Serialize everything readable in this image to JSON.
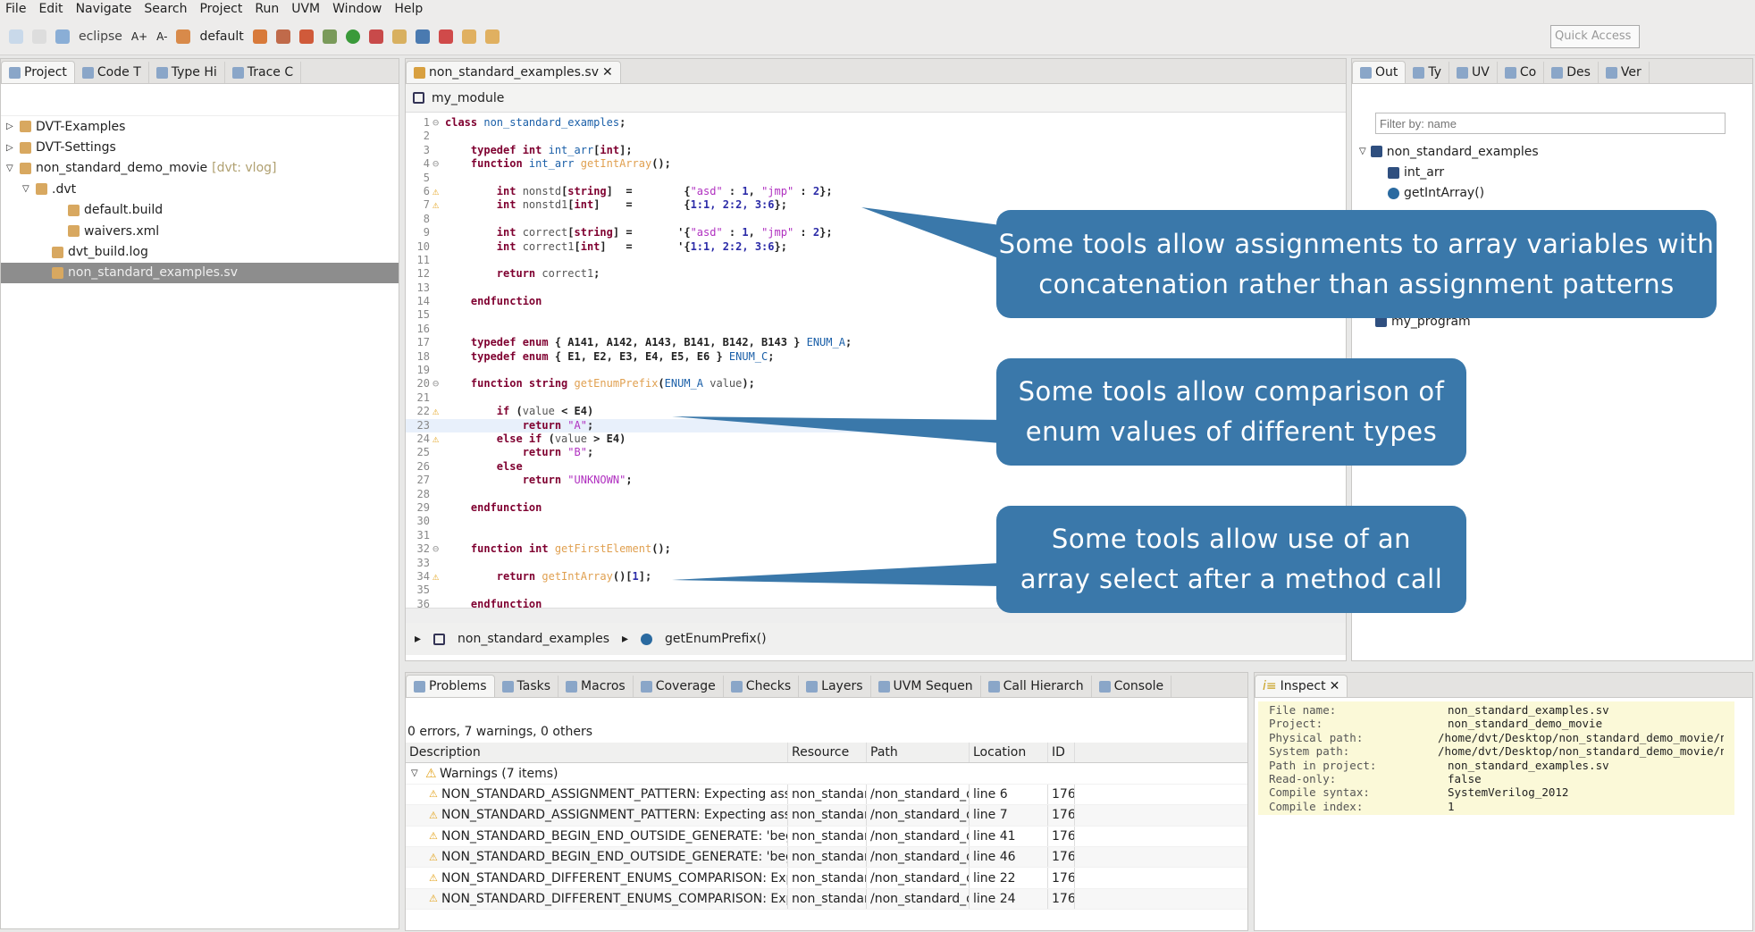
{
  "menu": [
    "File",
    "Edit",
    "Navigate",
    "Search",
    "Project",
    "Run",
    "UVM",
    "Window",
    "Help"
  ],
  "toolbar": {
    "perspective1": "eclipse",
    "font_up": "A+",
    "font_down": "A-",
    "config": "default",
    "quick_access": "Quick Access"
  },
  "project_panel": {
    "tabs": [
      "Project",
      "Code T",
      "Type Hi",
      "Trace C"
    ],
    "tree": [
      {
        "label": "DVT-Examples",
        "level": 0,
        "arrow": "▷"
      },
      {
        "label": "DVT-Settings",
        "level": 0,
        "arrow": "▷"
      },
      {
        "label": "non_standard_demo_movie",
        "suffix": "[dvt: vlog]",
        "level": 0,
        "arrow": "▽"
      },
      {
        "label": ".dvt",
        "level": 1,
        "arrow": "▽"
      },
      {
        "label": "default.build",
        "level": 3,
        "arrow": ""
      },
      {
        "label": "waivers.xml",
        "level": 3,
        "arrow": ""
      },
      {
        "label": "dvt_build.log",
        "level": 2,
        "arrow": ""
      },
      {
        "label": "non_standard_examples.sv",
        "level": 2,
        "arrow": "",
        "selected": true
      }
    ]
  },
  "editor": {
    "tab": "non_standard_examples.sv",
    "module": "my_module",
    "breadcrumb": [
      "non_standard_examples",
      "getEnumPrefix()"
    ],
    "lines": [
      {
        "n": "1",
        "f": "⊖",
        "s": [
          [
            "class ",
            "kw"
          ],
          [
            "non_standard_examples",
            "ty"
          ],
          [
            ";",
            "pl"
          ]
        ]
      },
      {
        "n": "2",
        "s": []
      },
      {
        "n": "3",
        "s": [
          [
            "    typedef int ",
            "kw"
          ],
          [
            "int_arr",
            "ty"
          ],
          [
            "[",
            "pl"
          ],
          [
            "int",
            "kw"
          ],
          [
            "];",
            "pl"
          ]
        ]
      },
      {
        "n": "4",
        "f": "⊖",
        "s": [
          [
            "    function ",
            "kw"
          ],
          [
            "int_arr ",
            "ty"
          ],
          [
            "getIntArray",
            "fn"
          ],
          [
            "();",
            "pl"
          ]
        ]
      },
      {
        "n": "5",
        "s": []
      },
      {
        "n": "6",
        "w": true,
        "s": [
          [
            "        int ",
            "kw"
          ],
          [
            "nonstd",
            "id"
          ],
          [
            "[",
            "pl"
          ],
          [
            "string",
            "kw"
          ],
          [
            "]  =        {",
            "pl"
          ],
          [
            "\"asd\"",
            "str"
          ],
          [
            " : ",
            "pl"
          ],
          [
            "1",
            "num"
          ],
          [
            ", ",
            "pl"
          ],
          [
            "\"jmp\"",
            "str"
          ],
          [
            " : ",
            "pl"
          ],
          [
            "2",
            "num"
          ],
          [
            "};",
            "pl"
          ]
        ]
      },
      {
        "n": "7",
        "w": true,
        "s": [
          [
            "        int ",
            "kw"
          ],
          [
            "nonstd1",
            "id"
          ],
          [
            "[",
            "pl"
          ],
          [
            "int",
            "kw"
          ],
          [
            "]    =        {",
            "pl"
          ],
          [
            "1:1, 2:2, 3:6",
            "num"
          ],
          [
            "};",
            "pl"
          ]
        ]
      },
      {
        "n": "8",
        "s": []
      },
      {
        "n": "9",
        "s": [
          [
            "        int ",
            "kw"
          ],
          [
            "correct",
            "id"
          ],
          [
            "[",
            "pl"
          ],
          [
            "string",
            "kw"
          ],
          [
            "] =       '{",
            "pl"
          ],
          [
            "\"asd\"",
            "str"
          ],
          [
            " : ",
            "pl"
          ],
          [
            "1",
            "num"
          ],
          [
            ", ",
            "pl"
          ],
          [
            "\"jmp\"",
            "str"
          ],
          [
            " : ",
            "pl"
          ],
          [
            "2",
            "num"
          ],
          [
            "};",
            "pl"
          ]
        ]
      },
      {
        "n": "10",
        "s": [
          [
            "        int ",
            "kw"
          ],
          [
            "correct1",
            "id"
          ],
          [
            "[",
            "pl"
          ],
          [
            "int",
            "kw"
          ],
          [
            "]   =       '{",
            "pl"
          ],
          [
            "1:1, 2:2, 3:6",
            "num"
          ],
          [
            "};",
            "pl"
          ]
        ]
      },
      {
        "n": "11",
        "s": []
      },
      {
        "n": "12",
        "s": [
          [
            "        return ",
            "kw"
          ],
          [
            "correct1",
            "id"
          ],
          [
            ";",
            "pl"
          ]
        ]
      },
      {
        "n": "13",
        "s": []
      },
      {
        "n": "14",
        "s": [
          [
            "    endfunction",
            "kw"
          ]
        ]
      },
      {
        "n": "15",
        "s": []
      },
      {
        "n": "16",
        "s": []
      },
      {
        "n": "17",
        "s": [
          [
            "    typedef enum ",
            "kw"
          ],
          [
            "{ A141, A142, A143, B141, B142, B143 } ",
            "pl"
          ],
          [
            "ENUM_A",
            "ty"
          ],
          [
            ";",
            "pl"
          ]
        ]
      },
      {
        "n": "18",
        "s": [
          [
            "    typedef enum ",
            "kw"
          ],
          [
            "{ E1, E2, E3, E4, E5, E6 } ",
            "pl"
          ],
          [
            "ENUM_C",
            "ty"
          ],
          [
            ";",
            "pl"
          ]
        ]
      },
      {
        "n": "19",
        "s": []
      },
      {
        "n": "20",
        "f": "⊖",
        "s": [
          [
            "    function string ",
            "kw"
          ],
          [
            "getEnumPrefix",
            "fn"
          ],
          [
            "(",
            "pl"
          ],
          [
            "ENUM_A ",
            "ty"
          ],
          [
            "value",
            "id"
          ],
          [
            ");",
            "pl"
          ]
        ]
      },
      {
        "n": "21",
        "s": []
      },
      {
        "n": "22",
        "w": true,
        "s": [
          [
            "        if ",
            "kw"
          ],
          [
            "(",
            "pl"
          ],
          [
            "value",
            "id"
          ],
          [
            " < E4)",
            "pl"
          ]
        ]
      },
      {
        "n": "23",
        "hl": true,
        "s": [
          [
            "            return ",
            "kw"
          ],
          [
            "\"A\"",
            "str"
          ],
          [
            ";",
            "pl"
          ]
        ]
      },
      {
        "n": "24",
        "w": true,
        "s": [
          [
            "        else if ",
            "kw"
          ],
          [
            "(",
            "pl"
          ],
          [
            "value",
            "id"
          ],
          [
            " > E4)",
            "pl"
          ]
        ]
      },
      {
        "n": "25",
        "s": [
          [
            "            return ",
            "kw"
          ],
          [
            "\"B\"",
            "str"
          ],
          [
            ";",
            "pl"
          ]
        ]
      },
      {
        "n": "26",
        "s": [
          [
            "        else",
            "kw"
          ]
        ]
      },
      {
        "n": "27",
        "s": [
          [
            "            return ",
            "kw"
          ],
          [
            "\"UNKNOWN\"",
            "str"
          ],
          [
            ";",
            "pl"
          ]
        ]
      },
      {
        "n": "28",
        "s": []
      },
      {
        "n": "29",
        "s": [
          [
            "    endfunction",
            "kw"
          ]
        ]
      },
      {
        "n": "30",
        "s": []
      },
      {
        "n": "31",
        "s": []
      },
      {
        "n": "32",
        "f": "⊖",
        "s": [
          [
            "    function int ",
            "kw"
          ],
          [
            "getFirstElement",
            "fn"
          ],
          [
            "();",
            "pl"
          ]
        ]
      },
      {
        "n": "33",
        "s": []
      },
      {
        "n": "34",
        "w": true,
        "s": [
          [
            "        return ",
            "kw"
          ],
          [
            "getIntArray",
            "fn"
          ],
          [
            "()[",
            "pl"
          ],
          [
            "1",
            "num"
          ],
          [
            "];",
            "pl"
          ]
        ]
      },
      {
        "n": "35",
        "s": []
      },
      {
        "n": "36",
        "s": [
          [
            "    endfunction",
            "kw"
          ]
        ]
      }
    ]
  },
  "outline_panel": {
    "tabs": [
      "Out",
      "Ty",
      "UV",
      "Co",
      "Des",
      "Ver"
    ],
    "filter_placeholder": "Filter by: name",
    "tree": [
      {
        "label": "non_standard_examples",
        "level": 0
      },
      {
        "label": "int_arr",
        "level": 1
      },
      {
        "label": "getIntArray()",
        "level": 1
      },
      {
        "label": "my_program",
        "level": 0
      }
    ]
  },
  "callouts": [
    "Some tools allow assignments to array variables with concatenation rather than assignment patterns",
    "Some tools allow comparison of enum values of different types",
    "Some tools allow use of an array select after a method call"
  ],
  "callout_color": "#3a78aa",
  "problems": {
    "tabs": [
      "Problems",
      "Tasks",
      "Macros",
      "Coverage",
      "Checks",
      "Layers",
      "UVM Sequen",
      "Call Hierarch",
      "Console"
    ],
    "summary": "0 errors, 7 warnings, 0 others",
    "columns": [
      "Description",
      "Resource",
      "Path",
      "Location",
      "ID"
    ],
    "group": "Warnings (7 items)",
    "rows": [
      [
        "NON_STANDARD_ASSIGNMENT_PATTERN: Expecting assignment pa",
        "non_standard",
        "/non_standard_der",
        "line 6",
        "176"
      ],
      [
        "NON_STANDARD_ASSIGNMENT_PATTERN: Expecting assignment pa",
        "non_standard",
        "/non_standard_der",
        "line 7",
        "176"
      ],
      [
        "NON_STANDARD_BEGIN_END_OUTSIDE_GENERATE: 'begin/end' ge",
        "non_standard",
        "/non_standard_der",
        "line 41",
        "176"
      ],
      [
        "NON_STANDARD_BEGIN_END_OUTSIDE_GENERATE: 'begin/end' ge",
        "non_standard",
        "/non_standard_der",
        "line 46",
        "176"
      ],
      [
        "NON_STANDARD_DIFFERENT_ENUMS_COMPARISON: Explicit cast r",
        "non_standard",
        "/non_standard_der",
        "line 22",
        "176"
      ],
      [
        "NON_STANDARD_DIFFERENT_ENUMS_COMPARISON: Explicit cast r",
        "non_standard",
        "/non_standard_der",
        "line 24",
        "176"
      ]
    ]
  },
  "inspect": {
    "tab": "Inspect",
    "rows": [
      [
        "File name:",
        "non_standard_examples.sv"
      ],
      [
        "Project:",
        "non_standard_demo_movie"
      ],
      [
        "Physical path:",
        "/home/dvt/Desktop/non_standard_demo_movie/non"
      ],
      [
        "System path:",
        "/home/dvt/Desktop/non_standard_demo_movie/non"
      ],
      [
        "Path in project:",
        "non_standard_examples.sv"
      ],
      [
        "Read-only:",
        "false"
      ],
      [
        "Compile syntax:",
        "SystemVerilog_2012"
      ],
      [
        "Compile index:",
        "1"
      ]
    ]
  }
}
